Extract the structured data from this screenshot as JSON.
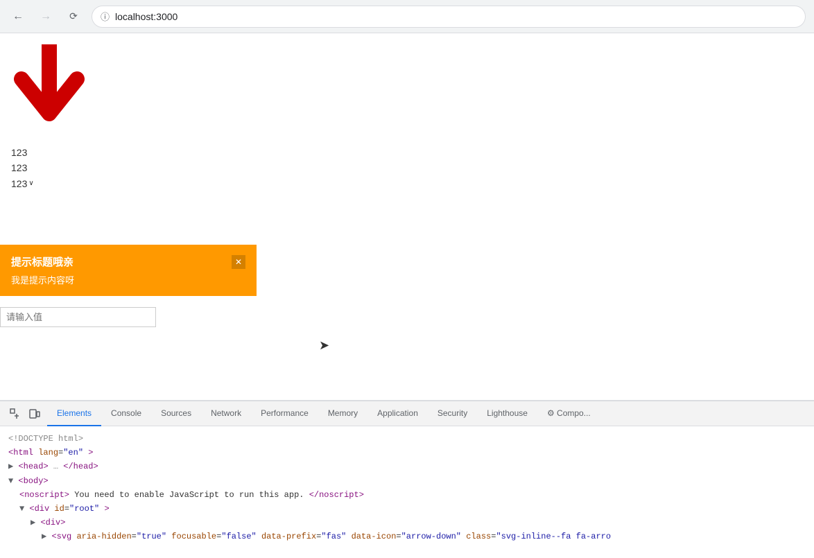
{
  "browser": {
    "url": "localhost:3000",
    "back_disabled": false,
    "forward_disabled": true
  },
  "page": {
    "arrow_symbol": "↓",
    "text1": "123",
    "text2": "123",
    "text3": "123",
    "select_arrow": "∨",
    "toast": {
      "title": "提示标题哦亲",
      "body": "我是提示内容呀",
      "close_symbol": "✕"
    },
    "input_placeholder": "请输入值"
  },
  "devtools": {
    "tabs": [
      {
        "id": "elements",
        "label": "Elements",
        "active": true
      },
      {
        "id": "console",
        "label": "Console",
        "active": false
      },
      {
        "id": "sources",
        "label": "Sources",
        "active": false
      },
      {
        "id": "network",
        "label": "Network",
        "active": false
      },
      {
        "id": "performance",
        "label": "Performance",
        "active": false
      },
      {
        "id": "memory",
        "label": "Memory",
        "active": false
      },
      {
        "id": "application",
        "label": "Application",
        "active": false
      },
      {
        "id": "security",
        "label": "Security",
        "active": false
      },
      {
        "id": "lighthouse",
        "label": "Lighthouse",
        "active": false
      },
      {
        "id": "components",
        "label": "⚙ Compo...",
        "active": false
      }
    ],
    "code_lines": [
      {
        "indent": 0,
        "content": "<!DOCTYPE html>"
      },
      {
        "indent": 0,
        "content": "<html lang=\"en\">"
      },
      {
        "indent": 0,
        "content": "▶ <head>…</head>"
      },
      {
        "indent": 0,
        "content": "▼ <body>"
      },
      {
        "indent": 1,
        "content": "<noscript>You need to enable JavaScript to run this app.</noscript>"
      },
      {
        "indent": 1,
        "content": "▼ <div id=\"root\">"
      },
      {
        "indent": 2,
        "content": "▶ <div>"
      },
      {
        "indent": 3,
        "content": "▶ <svg aria-hidden=\"true\" focusable=\"false\" data-prefix=\"fas\" data-icon=\"arrow-down\" class=\"svg-inline--fa fa-arro"
      }
    ]
  }
}
